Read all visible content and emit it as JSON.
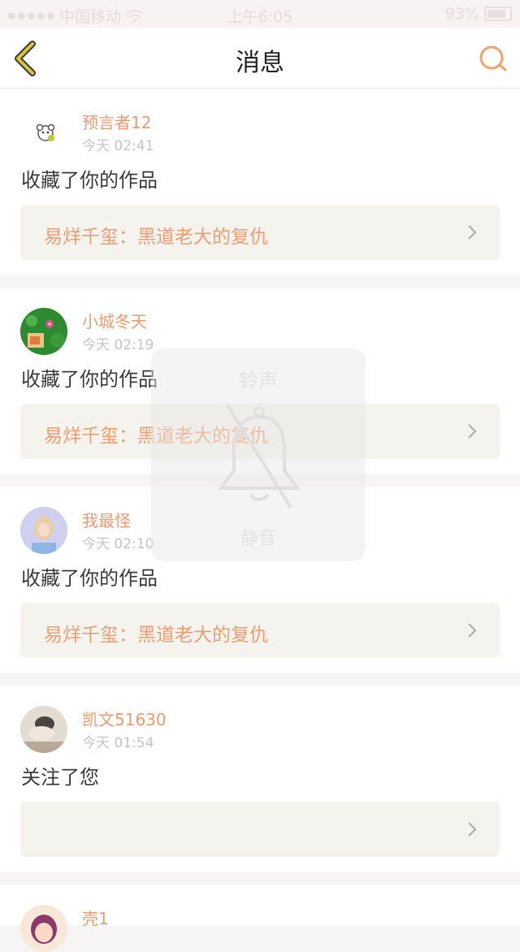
{
  "status_bar": {
    "carrier": "中国移动",
    "time": "上午6:05",
    "battery": "93%"
  },
  "nav": {
    "title": "消息",
    "back_icon": "chevron-left-icon",
    "search_icon": "search-icon"
  },
  "messages": [
    {
      "user": "预言者12",
      "time": "今天 02:41",
      "action": "收藏了你的作品",
      "work": "易烊千玺：黑道老大的复仇"
    },
    {
      "user": "小城冬天",
      "time": "今天 02:19",
      "action": "收藏了你的作品",
      "work": "易烊千玺：黑道老大的复仇"
    },
    {
      "user": "我最怪",
      "time": "今天 02:10",
      "action": "收藏了你的作品",
      "work": "易烊千玺：黑道老大的复仇"
    },
    {
      "user": "凯文51630",
      "time": "今天 01:54",
      "action": "关注了您",
      "work": ""
    },
    {
      "user": "壳1",
      "time": "",
      "action": "",
      "work": ""
    }
  ],
  "overlay": {
    "top_label": "铃声",
    "bottom_label": "静音",
    "icon": "bell-muted-icon"
  },
  "colors": {
    "accent": "#eb9a70",
    "back_icon": "#d9c43a",
    "search_icon": "#f0a36e",
    "work_bg": "#f4f3ed"
  }
}
